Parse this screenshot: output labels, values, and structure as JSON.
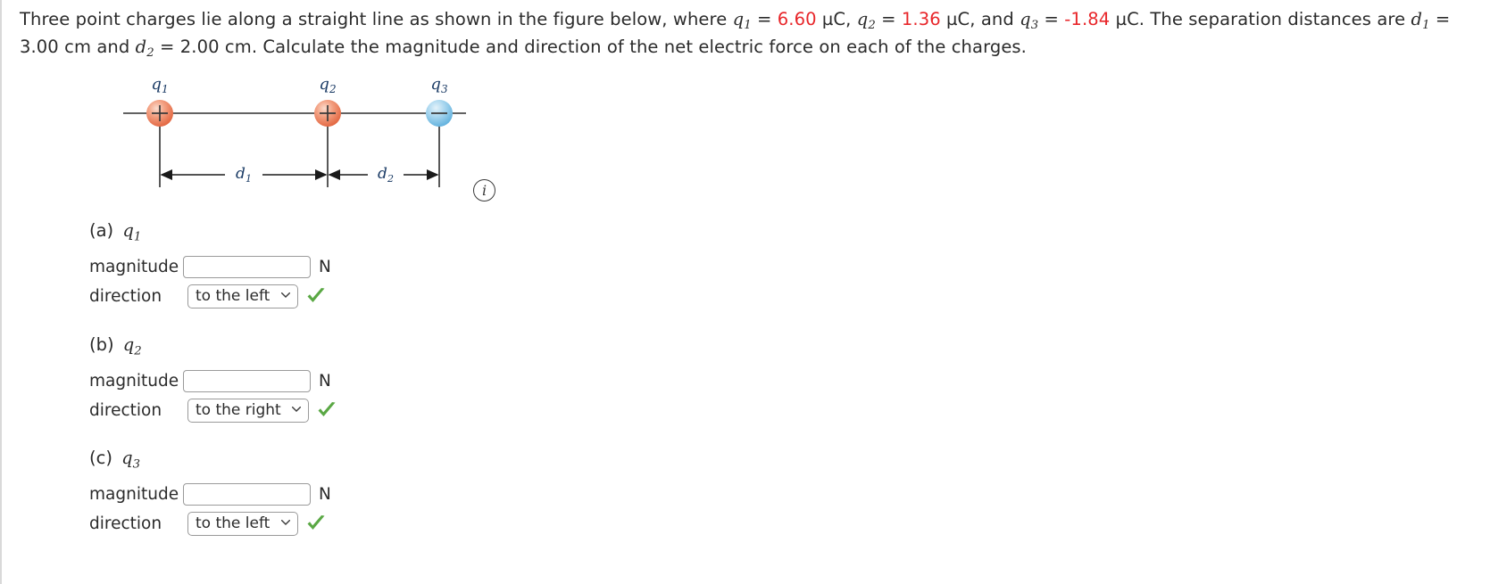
{
  "problem": {
    "line1_part1": "Three point charges lie along a straight line as shown in the figure below, where ",
    "q1_symbol": "q",
    "q1_sub": "1",
    "eq1": " = ",
    "q1_value": "6.60",
    "unit_uc": " µC, ",
    "q2_symbol": "q",
    "q2_sub": "2",
    "eq2": " = ",
    "q2_value": "1.36",
    "unit_uc2": " µC, and ",
    "q3_symbol": "q",
    "q3_sub": "3",
    "eq3": " = ",
    "q3_value": "-1.84",
    "line1_tail": " µC. The separation distances are",
    "d1_symbol": "d",
    "d1_sub": "1",
    "d1_text": " = 3.00 cm and ",
    "d2_symbol": "d",
    "d2_sub": "2",
    "d2_text": " = 2.00 cm. Calculate the magnitude and direction of the net electric force on each of the charges."
  },
  "figure": {
    "label_q1": "q",
    "label_q1_sub": "1",
    "label_q2": "q",
    "label_q2_sub": "2",
    "label_q3": "q",
    "label_q3_sub": "3",
    "charge1_sign": "+",
    "charge2_sign": "+",
    "charge3_sign": "−",
    "dim_d1": "d",
    "dim_d1_sub": "1",
    "dim_d2": "d",
    "dim_d2_sub": "2",
    "positive_color": "#e8663f",
    "negative_color": "#6fb9e0",
    "info_icon_label": "i"
  },
  "parts": [
    {
      "id": "a",
      "heading_prefix": "(a) ",
      "heading_symbol": "q",
      "heading_sub": "1",
      "magnitude_label": "magnitude",
      "magnitude_value": "",
      "magnitude_unit": "N",
      "direction_label": "direction",
      "direction_value": "to the left",
      "direction_options": [
        "to the left",
        "to the right"
      ],
      "status": "correct"
    },
    {
      "id": "b",
      "heading_prefix": "(b) ",
      "heading_symbol": "q",
      "heading_sub": "2",
      "magnitude_label": "magnitude",
      "magnitude_value": "",
      "magnitude_unit": "N",
      "direction_label": "direction",
      "direction_value": "to the right",
      "direction_options": [
        "to the left",
        "to the right"
      ],
      "status": "correct"
    },
    {
      "id": "c",
      "heading_prefix": "(c) ",
      "heading_symbol": "q",
      "heading_sub": "3",
      "magnitude_label": "magnitude",
      "magnitude_value": "",
      "magnitude_unit": "N",
      "direction_label": "direction",
      "direction_value": "to the left",
      "direction_options": [
        "to the left",
        "to the right"
      ],
      "status": "correct"
    }
  ],
  "colors": {
    "value_red": "#e8262a",
    "check_green": "#5aa844",
    "text": "#2b2b2b"
  }
}
